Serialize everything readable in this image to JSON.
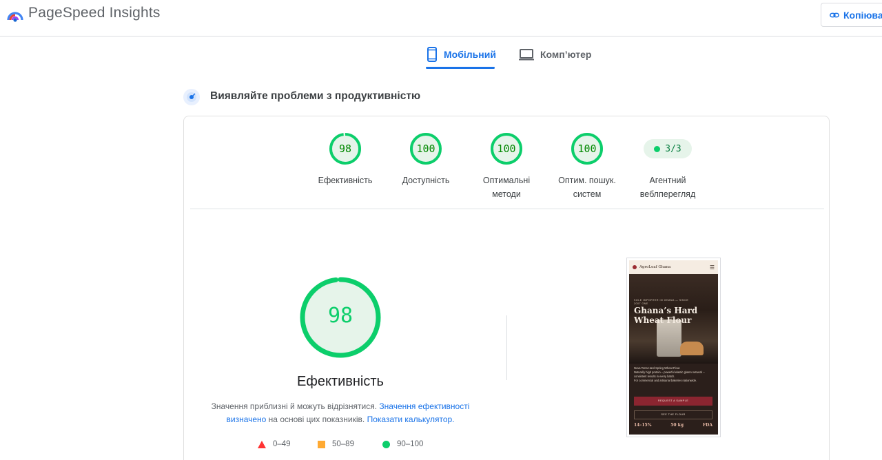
{
  "header": {
    "brand": "PageSpeed Insights",
    "copy_label": "Копіюват",
    "colors": {
      "accent": "#1a73e8",
      "good": "#0cce6b"
    }
  },
  "tabs": [
    {
      "label": "Мобільний",
      "icon": "smartphone-icon",
      "selected": true
    },
    {
      "label": "Комп’ютер",
      "icon": "laptop-icon",
      "selected": false
    }
  ],
  "section": {
    "title": "Виявляйте проблеми з продуктивністю",
    "icon": "diagnose-icon"
  },
  "categories": [
    {
      "score": "98",
      "score_value": 98,
      "label_lines": [
        "Ефективність",
        ""
      ]
    },
    {
      "score": "100",
      "score_value": 100,
      "label_lines": [
        "Доступність",
        ""
      ]
    },
    {
      "score": "100",
      "score_value": 100,
      "label_lines": [
        "Оптимальні",
        "методи"
      ]
    },
    {
      "score": "100",
      "score_value": 100,
      "label_lines": [
        "Оптим. пошук.",
        "систем"
      ]
    },
    {
      "pill": "3/3",
      "label_lines": [
        "Агентний",
        "веблперегляд"
      ]
    }
  ],
  "performance": {
    "score": "98",
    "score_value": 98,
    "title": "Ефективність",
    "note_text_1": "Значення приблизні й можуть відрізнятися. ",
    "note_link_1": "Значення ефективності визначено",
    "note_text_2": " на основі цих показників. ",
    "note_link_2": "Показати калькулятор."
  },
  "legend": [
    {
      "shape": "triangle",
      "color": "#ff3333",
      "range": "0–49"
    },
    {
      "shape": "square",
      "color": "#ffaa33",
      "range": "50–89"
    },
    {
      "shape": "circle",
      "color": "#0cce6b",
      "range": "90–100"
    }
  ],
  "screenshot": {
    "brand": "AgroLeaf Ghana",
    "kicker": "SOLE IMPORTER IN GHANA — SINCE 2007 ONE",
    "title": "Ghana’s Hard Wheat Flour",
    "body_1": "Nova Terra Hard Spring Wheat Flour.",
    "body_2": "Naturally high protein – powerful elastic gluten network – consistent results in every batch.",
    "body_3": "For commercial and artisanal bakeries nationwide.",
    "button_1": "REQUEST A SAMPLE",
    "button_2": "SEE THE FLOUR",
    "stat_1": "14–15%",
    "stat_2": "50 kg",
    "stat_3": "FDA"
  }
}
